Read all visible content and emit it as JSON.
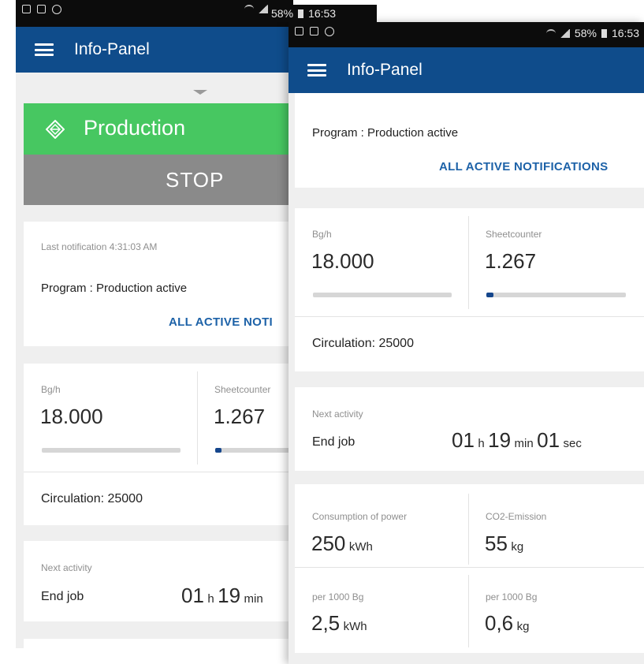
{
  "status_bar": {
    "battery": "58%",
    "time": "16:53"
  },
  "app": {
    "title": "Info-Panel"
  },
  "colors": {
    "appbar": "#0f4c8b",
    "production": "#47c761",
    "stop": "#8a8a8a",
    "accent": "#1d62a8"
  },
  "production": {
    "label": "Production",
    "stop_label": "STOP"
  },
  "notification": {
    "last": "Last notification 4:31:03 AM",
    "program": "Program : Production active",
    "link_left": "ALL ACTIVE NOTI",
    "link_right": "ALL ACTIVE NOTIFICATIONS"
  },
  "metrics": {
    "bgh": {
      "label": "Bg/h",
      "value": "18.000",
      "progress": 0
    },
    "sheetcounter": {
      "label": "Sheetcounter",
      "value": "1.267",
      "progress": 0.05
    },
    "circulation": "Circulation: 25000"
  },
  "next_activity": {
    "label": "Next activity",
    "name": "End job",
    "h": "01",
    "h_unit": "h",
    "min": "19",
    "min_unit": "min",
    "sec": "01",
    "sec_unit": "sec"
  },
  "consumption": {
    "power_label": "Consumption of power",
    "power_value": "250",
    "power_unit": "kWh",
    "co2_label": "CO2-Emission",
    "co2_value": "55",
    "co2_unit": "kg",
    "per_label": "per 1000 Bg",
    "per_power_value": "2,5",
    "per_power_unit": "kWh",
    "per_co2_value": "0,6",
    "per_co2_unit": "kg"
  }
}
